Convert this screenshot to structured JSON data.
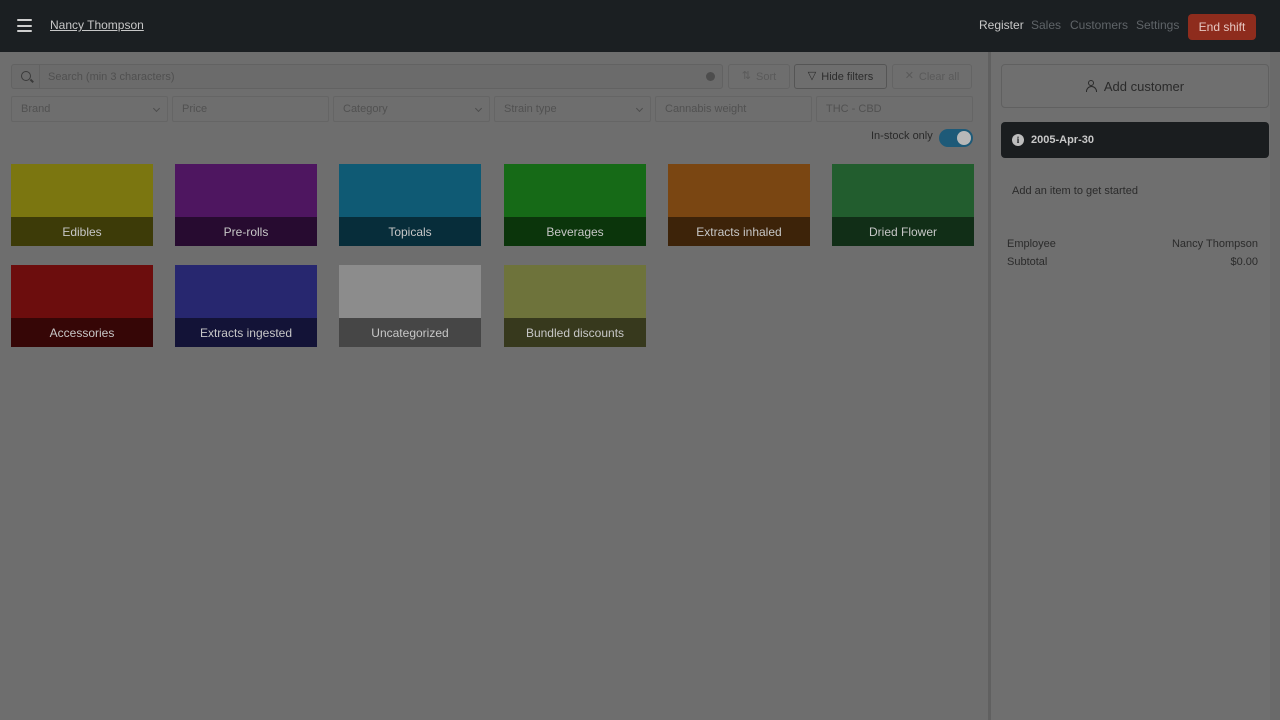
{
  "header": {
    "user_name": "Nancy Thompson",
    "nav": [
      {
        "label": "Register",
        "active": true
      },
      {
        "label": "Sales",
        "active": false
      },
      {
        "label": "Customers",
        "active": false
      },
      {
        "label": "Settings",
        "active": false
      }
    ],
    "end_shift_label": "End shift"
  },
  "search": {
    "placeholder": "Search (min 3 characters)",
    "value": ""
  },
  "toolbar": {
    "sort_label": "Sort",
    "hide_filters_label": "Hide filters",
    "clear_all_label": "Clear all"
  },
  "filters": [
    {
      "label": "Brand",
      "has_dropdown": true
    },
    {
      "label": "Price",
      "has_dropdown": false
    },
    {
      "label": "Category",
      "has_dropdown": true
    },
    {
      "label": "Strain type",
      "has_dropdown": true
    },
    {
      "label": "Cannabis weight",
      "has_dropdown": false
    },
    {
      "label": "THC - CBD",
      "has_dropdown": false
    }
  ],
  "in_stock": {
    "label": "In-stock only",
    "enabled": true
  },
  "categories": [
    {
      "label": "Edibles",
      "color": "#7b7610"
    },
    {
      "label": "Pre-rolls",
      "color": "#4e1660"
    },
    {
      "label": "Topicals",
      "color": "#0f5a74"
    },
    {
      "label": "Beverages",
      "color": "#166a17"
    },
    {
      "label": "Extracts inhaled",
      "color": "#7a4612"
    },
    {
      "label": "Dried Flower",
      "color": "#225d2e"
    },
    {
      "label": "Accessories",
      "color": "#6c0d0d"
    },
    {
      "label": "Extracts ingested",
      "color": "#27276f"
    },
    {
      "label": "Uncategorized",
      "color": "#8c8c8c"
    },
    {
      "label": "Bundled discounts",
      "color": "#6e733b"
    }
  ],
  "cart": {
    "add_customer_label": "Add customer",
    "date": "2005-Apr-30",
    "empty_message": "Add an item to get started",
    "employee_label": "Employee",
    "employee_value": "Nancy Thompson",
    "subtotal_label": "Subtotal",
    "subtotal_value": "$0.00"
  }
}
